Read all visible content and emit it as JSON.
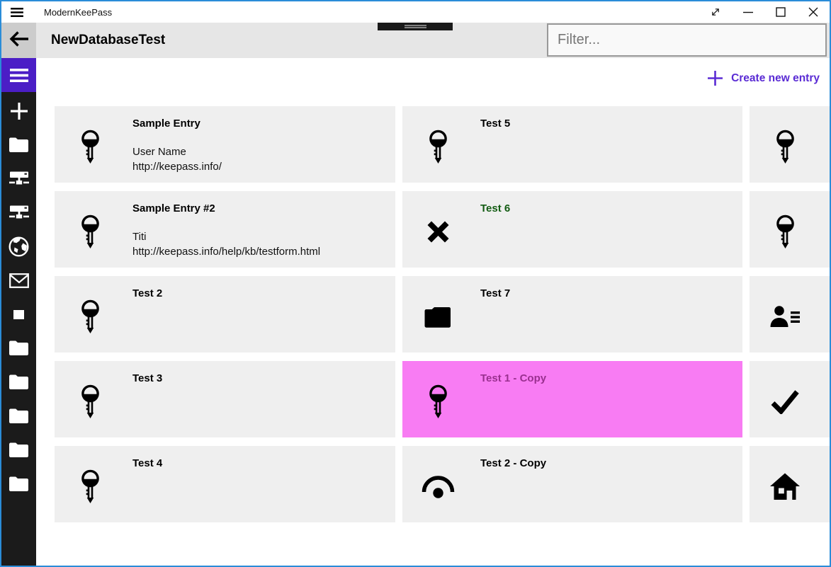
{
  "titlebar": {
    "app_title": "ModernKeePass",
    "menu_icon": "hamburger",
    "controls": [
      {
        "icon": "fullscreen-toggle",
        "name": "fullscreen-toggle-button"
      },
      {
        "icon": "minimize",
        "name": "minimize-button"
      },
      {
        "icon": "maximize",
        "name": "maximize-button"
      },
      {
        "icon": "close",
        "name": "close-button"
      }
    ]
  },
  "header": {
    "title": "NewDatabaseTest",
    "back_icon": "back-arrow",
    "filter_placeholder": "Filter..."
  },
  "toolbar": {
    "create_label": "Create new entry",
    "create_icon": "plus"
  },
  "sidebar": {
    "menu_icon": "hamburger",
    "items": [
      {
        "icon": "plus"
      },
      {
        "icon": "folder"
      },
      {
        "icon": "network-drive"
      },
      {
        "icon": "network-drive"
      },
      {
        "icon": "globe"
      },
      {
        "icon": "mail"
      },
      {
        "icon": "square"
      },
      {
        "icon": "folder"
      },
      {
        "icon": "folder"
      },
      {
        "icon": "folder"
      },
      {
        "icon": "folder"
      },
      {
        "icon": "folder"
      }
    ]
  },
  "entries": {
    "columns": [
      {
        "cards": [
          {
            "icon": "key",
            "title": "Sample Entry",
            "lines": [
              "User Name",
              "http://keepass.info/"
            ]
          },
          {
            "icon": "key",
            "title": "Sample Entry #2",
            "lines": [
              "Titi",
              "http://keepass.info/help/kb/testform.html"
            ]
          },
          {
            "icon": "key",
            "title": "Test 2",
            "lines": []
          },
          {
            "icon": "key",
            "title": "Test 3",
            "lines": []
          },
          {
            "icon": "key",
            "title": "Test 4",
            "lines": []
          }
        ]
      },
      {
        "cards": [
          {
            "icon": "key",
            "title": "Test 5",
            "lines": []
          },
          {
            "icon": "cross",
            "title": "Test 6",
            "lines": [],
            "title_color": "#135c13"
          },
          {
            "icon": "folder",
            "title": "Test 7",
            "lines": []
          },
          {
            "icon": "key",
            "title": "Test 1 - Copy",
            "lines": [],
            "selected": true
          },
          {
            "icon": "eye",
            "title": "Test 2 - Copy",
            "lines": []
          }
        ]
      },
      {
        "cards": [
          {
            "icon": "key",
            "title": "",
            "lines": []
          },
          {
            "icon": "key",
            "title": "",
            "lines": []
          },
          {
            "icon": "contact",
            "title": "",
            "lines": []
          },
          {
            "icon": "check",
            "title": "",
            "lines": []
          },
          {
            "icon": "home",
            "title": "",
            "lines": []
          }
        ]
      }
    ]
  },
  "colors": {
    "window_border": "#2a8cd8",
    "titlebar_bg": "#ffffff",
    "header_bg": "#e6e6e6",
    "back_button_bg": "#cccccc",
    "sidebar_bg": "#1b1b1b",
    "accent_purple": "#4b1ec6",
    "link_purple": "#5a2bd4",
    "card_bg": "#efefef",
    "selected_card_bg": "#f87cf3",
    "selected_title": "#99308f",
    "green_title": "#135c13",
    "text": "#000000",
    "placeholder": "#767676"
  }
}
